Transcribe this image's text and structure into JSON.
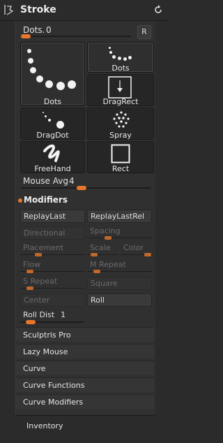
{
  "header": {
    "title": "Stroke",
    "icon": "stroke-icon",
    "reset_icon": "refresh-icon"
  },
  "dots_slider": {
    "label": "Dots.",
    "value": "0",
    "reset_label": "R"
  },
  "strokes": [
    {
      "label": "Dots",
      "icon": "dots-stroke-icon",
      "selected": true
    },
    {
      "label": "Dots",
      "icon": "dots-small-icon",
      "selected": true
    },
    {
      "label": "DragRect",
      "icon": "dragrect-icon",
      "selected": false
    },
    {
      "label": "DragDot",
      "icon": "dragdot-icon",
      "selected": false
    },
    {
      "label": "Spray",
      "icon": "spray-icon",
      "selected": false
    },
    {
      "label": "FreeHand",
      "icon": "freehand-icon",
      "selected": false
    },
    {
      "label": "Rect",
      "icon": "rect-icon",
      "selected": false
    }
  ],
  "mouse_avg": {
    "label": "Mouse Avg",
    "value": "4"
  },
  "modifiers": {
    "title": "Modifiers",
    "replay_last": "ReplayLast",
    "replay_last_rel": "ReplayLastRel",
    "directional": "Directional",
    "spacing": "Spacing",
    "placement": "Placement",
    "scale": "Scale",
    "color": "Color",
    "flow": "Flow",
    "m_repeat": "M Repeat",
    "s_repeat": "S Repeat",
    "square": "Square",
    "center": "Center",
    "roll": "Roll"
  },
  "roll_dist": {
    "label": "Roll Dist",
    "value": "1"
  },
  "subpalettes": [
    "Sculptris Pro",
    "Lazy Mouse",
    "Curve",
    "Curve Functions",
    "Curve Modifiers"
  ],
  "footer": {
    "inventory": "Inventory"
  },
  "colors": {
    "accent": "#e8762b",
    "background": "#2b2b2b",
    "panel": "#303030"
  }
}
